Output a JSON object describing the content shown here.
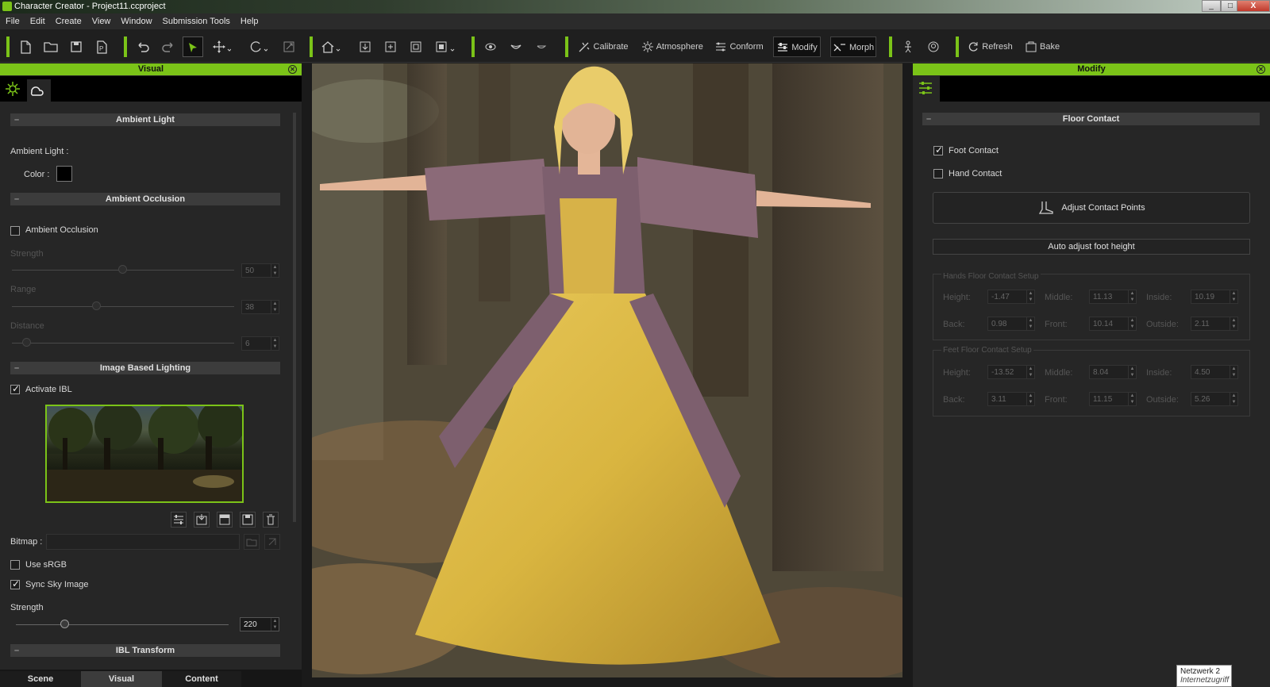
{
  "window": {
    "title": "Character Creator - Project11.ccproject",
    "minimize": "_",
    "maximize": "□",
    "close": "X"
  },
  "menu": [
    "File",
    "Edit",
    "Create",
    "View",
    "Window",
    "Submission Tools",
    "Help"
  ],
  "toolbar": {
    "calibrate": "Calibrate",
    "atmosphere": "Atmosphere",
    "conform": "Conform",
    "modify": "Modify",
    "morph": "Morph",
    "refresh": "Refresh",
    "bake": "Bake"
  },
  "left_panel": {
    "title": "Visual",
    "ambient_light": {
      "header": "Ambient Light",
      "label": "Ambient Light :",
      "color_label": "Color :",
      "color": "#000000"
    },
    "ambient_occlusion": {
      "header": "Ambient Occlusion",
      "checkbox": "Ambient Occlusion",
      "checked": false,
      "strength": {
        "label": "Strength",
        "value": "50"
      },
      "range": {
        "label": "Range",
        "value": "38"
      },
      "distance": {
        "label": "Distance",
        "value": "6"
      }
    },
    "ibl": {
      "header": "Image Based Lighting",
      "activate": "Activate IBL",
      "activate_checked": true,
      "bitmap_label": "Bitmap :",
      "use_srgb": "Use sRGB",
      "use_srgb_checked": false,
      "sync_sky": "Sync Sky Image",
      "sync_sky_checked": true,
      "strength_label": "Strength",
      "strength_value": "220"
    },
    "ibl_transform": {
      "header": "IBL Transform"
    },
    "tabs": [
      "Scene",
      "Visual",
      "Content"
    ],
    "active_tab": "Visual"
  },
  "right_panel": {
    "title": "Modify",
    "floor_contact": {
      "header": "Floor Contact",
      "foot_contact": "Foot Contact",
      "foot_checked": true,
      "hand_contact": "Hand Contact",
      "hand_checked": false,
      "adjust_points": "Adjust Contact Points",
      "auto_adjust": "Auto adjust foot height",
      "hands_group": {
        "title": "Hands Floor Contact Setup",
        "height_label": "Height:",
        "height": "-1.47",
        "middle_label": "Middle:",
        "middle": "11.13",
        "inside_label": "Inside:",
        "inside": "10.19",
        "back_label": "Back:",
        "back": "0.98",
        "front_label": "Front:",
        "front": "10.14",
        "outside_label": "Outside:",
        "outside": "2.11"
      },
      "feet_group": {
        "title": "Feet Floor Contact Setup",
        "height_label": "Height:",
        "height": "-13.52",
        "middle_label": "Middle:",
        "middle": "8.04",
        "inside_label": "Inside:",
        "inside": "4.50",
        "back_label": "Back:",
        "back": "3.11",
        "front_label": "Front:",
        "front": "11.15",
        "outside_label": "Outside:",
        "outside": "5.26"
      }
    }
  },
  "tray": {
    "network_name": "Netzwerk  2",
    "network_status": "Internetzugriff"
  }
}
